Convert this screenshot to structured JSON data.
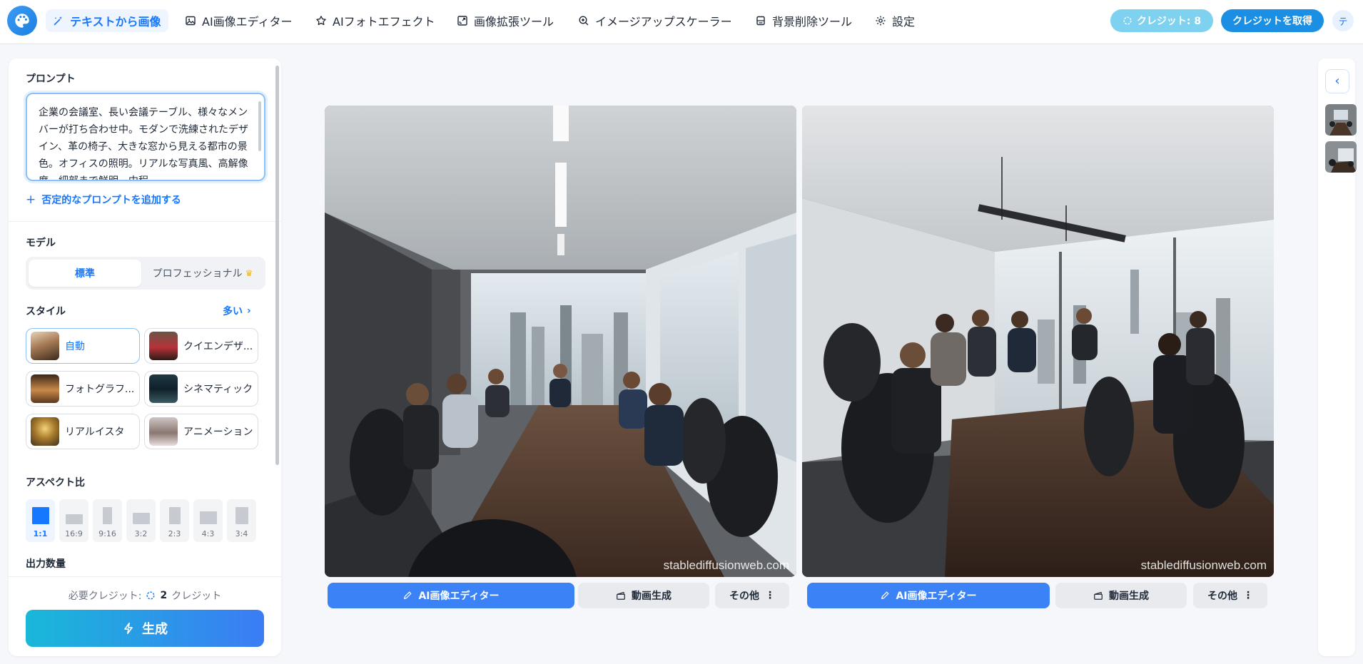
{
  "nav": {
    "items": [
      {
        "label": "テキストから画像",
        "icon": "magic-wand-icon",
        "active": true
      },
      {
        "label": "AI画像エディター",
        "icon": "image-icon"
      },
      {
        "label": "AIフォトエフェクト",
        "icon": "star-icon"
      },
      {
        "label": "画像拡張ツール",
        "icon": "expand-icon"
      },
      {
        "label": "イメージアップスケーラー",
        "icon": "zoom-in-icon"
      },
      {
        "label": "背景削除ツール",
        "icon": "eraser-icon"
      },
      {
        "label": "設定",
        "icon": "gear-icon"
      }
    ],
    "credits_label": "クレジット: 8",
    "get_credits_label": "クレジットを取得",
    "user_initial": "テ"
  },
  "panel": {
    "prompt_title": "プロンプト",
    "prompt_text": "企業の会議室、長い会議テーブル、様々なメンバーが打ち合わせ中。モダンで洗練されたデザイン、革の椅子、大きな窓から見える都市の景色。オフィスの照明。リアルな写真風、高解像度、細部まで鮮明、中程",
    "negative_prompt_label": "否定的なプロンプトを追加する",
    "model_title": "モデル",
    "model_options": [
      "標準",
      "プロフェッショナル"
    ],
    "model_selected": "標準",
    "style_title": "スタイル",
    "style_more": "多い",
    "styles": [
      {
        "label": "自動",
        "active": true
      },
      {
        "label": "クイエンデザ..."
      },
      {
        "label": "フォトグラフ..."
      },
      {
        "label": "シネマティック"
      },
      {
        "label": "リアルイスタ"
      },
      {
        "label": "アニメーション"
      }
    ],
    "aspect_title": "アスペクト比",
    "aspect_options": [
      "1:1",
      "16:9",
      "9:16",
      "3:2",
      "2:3",
      "4:3",
      "3:4"
    ],
    "aspect_selected": "1:1",
    "output_title": "出力数量",
    "cost_prefix": "必要クレジット:",
    "cost_amount": "2",
    "cost_unit": "クレジット",
    "generate_label": "生成"
  },
  "results": [
    {
      "watermark": "stablediffusionweb.com",
      "editor_label": "AI画像エディター",
      "video_label": "動画生成",
      "more_label": "その他"
    },
    {
      "watermark": "stablediffusionweb.com",
      "editor_label": "AI画像エディター",
      "video_label": "動画生成",
      "more_label": "その他"
    }
  ],
  "colors": {
    "accent": "#1677ff",
    "primary_button": "#3b82f6",
    "generate_gradient_start": "#19b8d8",
    "generate_gradient_end": "#3b7cf5"
  }
}
